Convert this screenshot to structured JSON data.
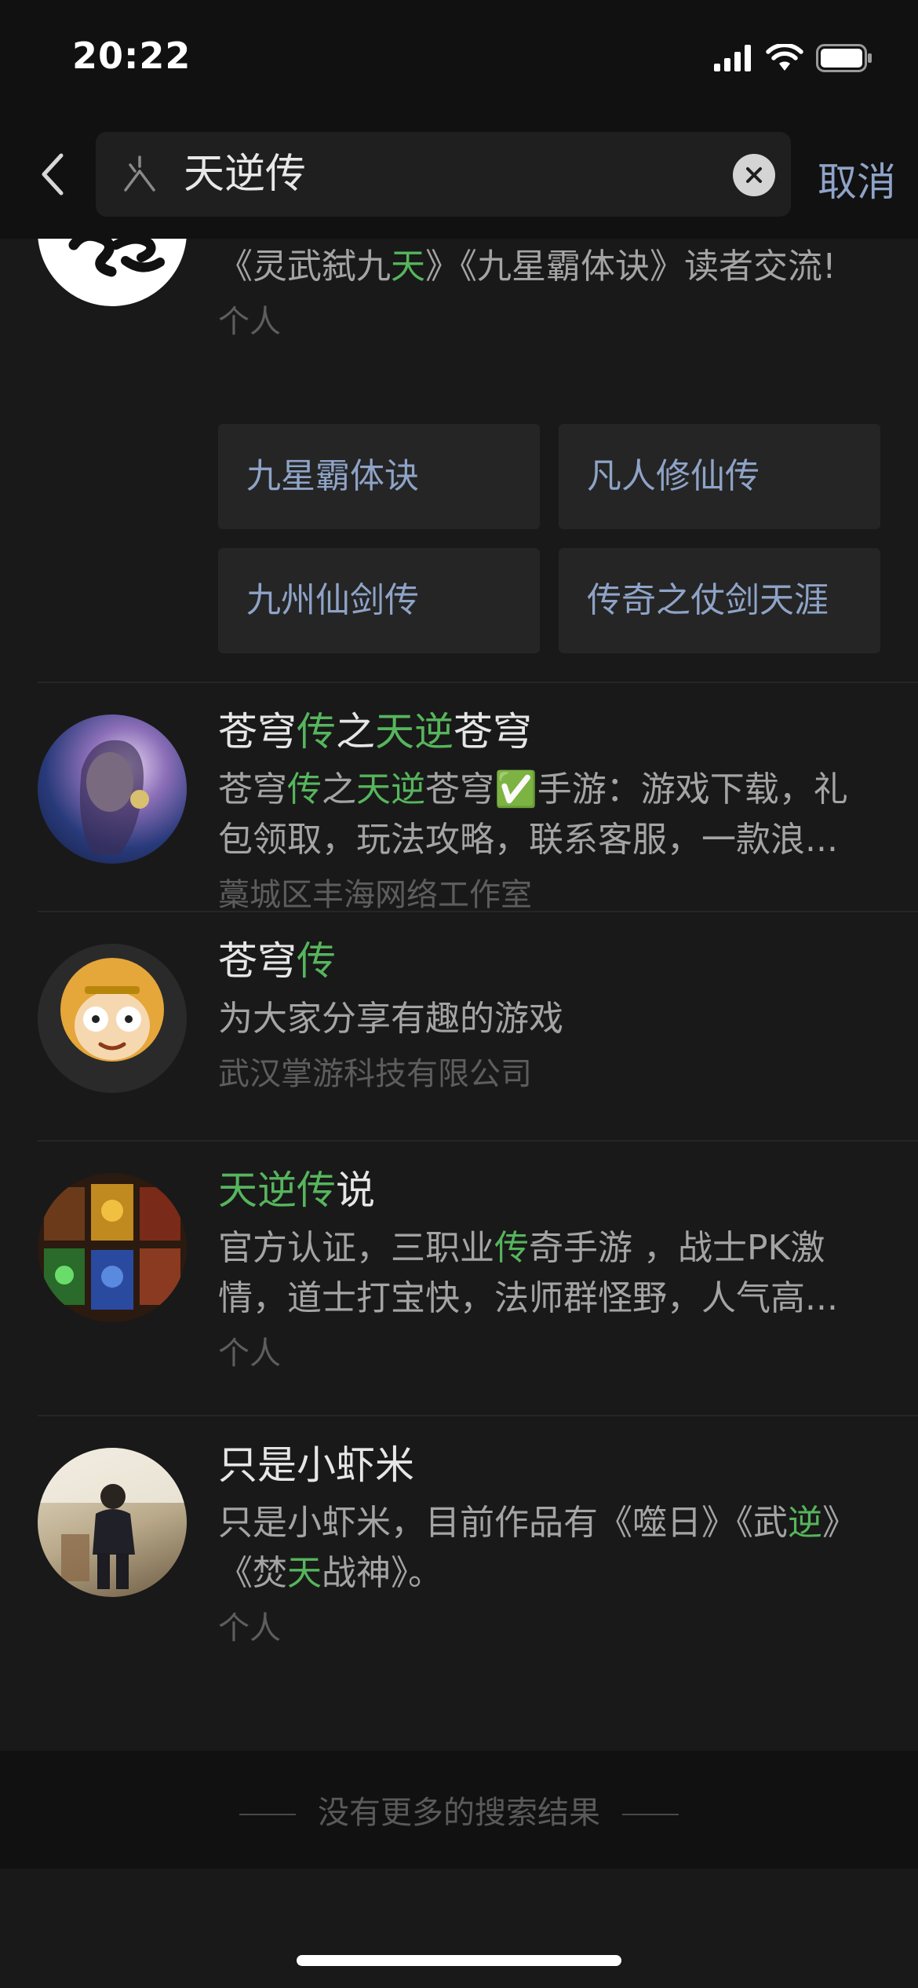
{
  "status_bar": {
    "time": "20:22"
  },
  "search": {
    "query": "天逆传",
    "cancel_label": "取消"
  },
  "results": [
    {
      "desc_parts": [
        {
          "t": "《灵武弑九",
          "h": false
        },
        {
          "t": "天",
          "h": true
        },
        {
          "t": "》《九星霸体诀》读者交流!",
          "h": false
        }
      ],
      "meta": "个人",
      "tags": [
        "九星霸体诀",
        "凡人修仙传",
        "九州仙剑传",
        "传奇之仗剑天涯"
      ]
    },
    {
      "title_parts": [
        {
          "t": "苍穹",
          "h": false
        },
        {
          "t": "传",
          "h": true
        },
        {
          "t": "之",
          "h": false
        },
        {
          "t": "天逆",
          "h": true
        },
        {
          "t": "苍穹",
          "h": false
        }
      ],
      "desc_parts": [
        {
          "t": "苍穹",
          "h": false
        },
        {
          "t": "传",
          "h": true
        },
        {
          "t": "之",
          "h": false
        },
        {
          "t": "天逆",
          "h": true
        },
        {
          "t": "苍穹✅手游：游戏下载，礼包领取，玩法攻略，联系客服，一款浪...",
          "h": false
        }
      ],
      "meta": "藁城区丰海网络工作室"
    },
    {
      "title_parts": [
        {
          "t": "苍穹",
          "h": false
        },
        {
          "t": "传",
          "h": true
        }
      ],
      "desc_parts": [
        {
          "t": "为大家分享有趣的游戏",
          "h": false
        }
      ],
      "meta": "武汉掌游科技有限公司"
    },
    {
      "title_parts": [
        {
          "t": "天逆传",
          "h": true
        },
        {
          "t": "说",
          "h": false
        }
      ],
      "desc_parts": [
        {
          "t": "官方认证，三职业",
          "h": false
        },
        {
          "t": "传",
          "h": true
        },
        {
          "t": "奇手游 ，战士PK激情，道士打宝快，法师群怪野，人气高...",
          "h": false
        }
      ],
      "meta": "个人"
    },
    {
      "title_parts": [
        {
          "t": "只是小虾米",
          "h": false
        }
      ],
      "desc_parts": [
        {
          "t": "只是小虾米，目前作品有《噬日》《武",
          "h": false
        },
        {
          "t": "逆",
          "h": true
        },
        {
          "t": "》《焚",
          "h": false
        },
        {
          "t": "天",
          "h": true
        },
        {
          "t": "战神》。",
          "h": false
        }
      ],
      "meta": "个人"
    }
  ],
  "footer": {
    "text": "没有更多的搜索结果"
  },
  "colors": {
    "highlight": "#56b55d",
    "link": "#8ea3c7",
    "background": "#111111",
    "card": "#191919"
  }
}
